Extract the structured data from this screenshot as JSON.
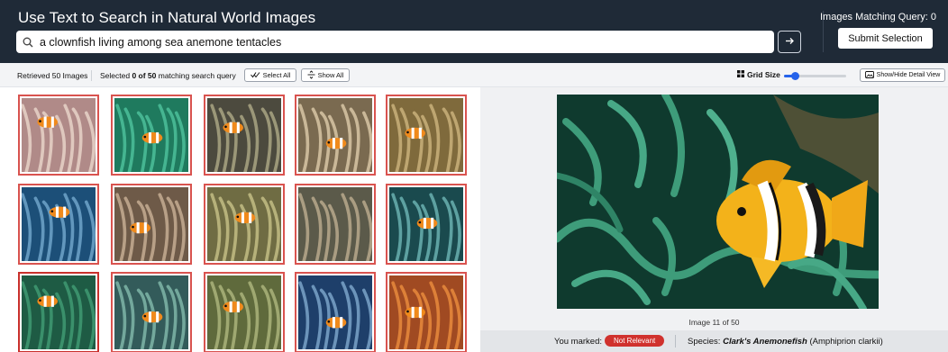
{
  "header": {
    "title": "Use Text to Search in Natural World Images",
    "search_value": "a clownfish living among sea anemone tentacles",
    "match_count": "Images Matching Query: 0",
    "submit_label": "Submit Selection"
  },
  "toolbar": {
    "retrieved": "Retrieved 50 Images",
    "selected_prefix": "Selected ",
    "selected_count": "0 of 50",
    "selected_suffix": " matching search query",
    "select_all": "Select All",
    "show_all": "Show All",
    "grid_size_label": "Grid Size",
    "grid_size_fraction": 0.18,
    "detail_toggle": "Show/Hide Detail View"
  },
  "grid": {
    "thumbnails": [
      {
        "icon": "anemone-photo",
        "bg": "#b08a88",
        "fg": "#e8d2c8",
        "fish": true
      },
      {
        "icon": "anemone-photo",
        "bg": "#1f7a5e",
        "fg": "#4cc09a",
        "fish": true
      },
      {
        "icon": "anemone-photo",
        "bg": "#4c4a3e",
        "fg": "#a9a483",
        "fish": true
      },
      {
        "icon": "anemone-photo",
        "bg": "#7a6a50",
        "fg": "#d8c6a4",
        "fish": true
      },
      {
        "icon": "anemone-photo",
        "bg": "#7f6a3c",
        "fg": "#c9b07a",
        "fish": true
      },
      {
        "icon": "anemone-photo",
        "bg": "#1c4f78",
        "fg": "#6fa3c9",
        "fish": true
      },
      {
        "icon": "anemone-photo",
        "bg": "#6e5a48",
        "fg": "#c5ad93",
        "fish": true
      },
      {
        "icon": "anemone-photo",
        "bg": "#6f6c43",
        "fg": "#c3bd84",
        "fish": true
      },
      {
        "icon": "anemone-photo",
        "bg": "#5b5a4a",
        "fg": "#b8a98c",
        "fish": false
      },
      {
        "icon": "anemone-photo",
        "bg": "#1a4a4e",
        "fg": "#6ab0b0",
        "fish": true
      },
      {
        "icon": "anemone-photo",
        "bg": "#1e5b44",
        "fg": "#3f9a72",
        "fish": true,
        "selected": true
      },
      {
        "icon": "anemone-photo",
        "bg": "#335b5a",
        "fg": "#7fb6a8",
        "fish": true
      },
      {
        "icon": "anemone-photo",
        "bg": "#5f6a3c",
        "fg": "#aab37a",
        "fish": true
      },
      {
        "icon": "anemone-photo",
        "bg": "#1e3f6a",
        "fg": "#7aa3c8",
        "fish": true
      },
      {
        "icon": "anemone-photo",
        "bg": "#a04a22",
        "fg": "#e88a3c",
        "fish": true
      }
    ]
  },
  "detail": {
    "image_icon": "clownfish-anemone-photo",
    "counter": "Image 11 of 50",
    "marked_label": "You marked:",
    "badge": "Not Relevant",
    "species_prefix": "Species: ",
    "species_common": "Clark's Anemonefish",
    "species_latin": " (Amphiprion clarkii)"
  },
  "colors": {
    "header_bg": "#1f2a37",
    "accent": "#2563eb",
    "not_relevant": "#d0312d",
    "thumb_border": "#d9534f"
  }
}
